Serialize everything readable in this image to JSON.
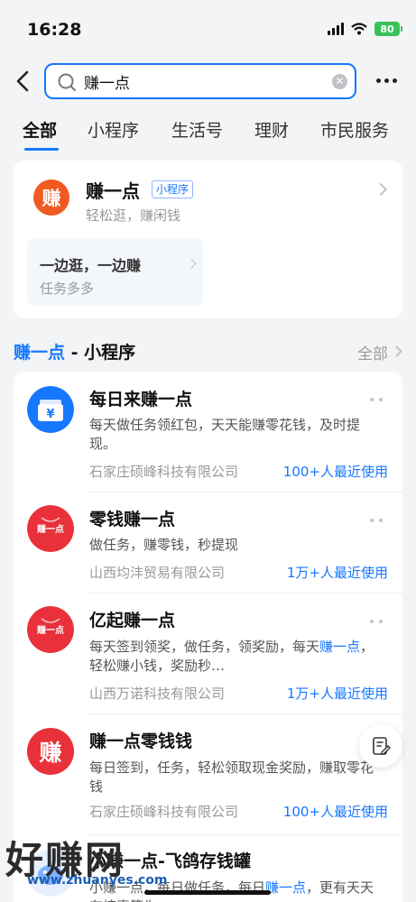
{
  "status_bar": {
    "time": "16:28",
    "battery": "80"
  },
  "search": {
    "value": "赚一点",
    "placeholder": ""
  },
  "tabs": [
    {
      "label": "全部",
      "active": true
    },
    {
      "label": "小程序"
    },
    {
      "label": "生活号"
    },
    {
      "label": "理财"
    },
    {
      "label": "市民服务"
    }
  ],
  "top_result": {
    "logo_char": "赚",
    "title": "赚一点",
    "badge": "小程序",
    "subtitle": "轻松逛，赚闲钱",
    "service": {
      "title": "一边逛，一边赚",
      "subtitle": "任务多多"
    }
  },
  "section": {
    "title_highlight": "赚一点",
    "title_rest": " - 小程序",
    "all_label": "全部"
  },
  "items": [
    {
      "title": "每日来赚一点",
      "desc": "每天做任务领红包，天天能赚零花钱，及时提现。",
      "company": "石家庄硕峰科技有限公司",
      "usage": "100+人最近使用",
      "logo": "wallet-icon"
    },
    {
      "title": "零钱赚一点",
      "desc": "做任务，赚零钱，秒提现",
      "company": "山西均沣贸易有限公司",
      "usage": "1万+人最近使用",
      "logo": "赚一点"
    },
    {
      "title": "亿起赚一点",
      "desc_a": "每天签到领奖，做任务，领奖励，每天",
      "desc_hl": "赚一点",
      "desc_b": "，轻松赚小钱，奖励秒…",
      "company": "山西万诺科技有限公司",
      "usage": "1万+人最近使用",
      "logo": "赚一点"
    },
    {
      "title": "赚一点零钱钱",
      "desc": "每日签到，任务，轻松领取现金奖励，赚取零花钱",
      "company": "石家庄硕峰科技有限公司",
      "usage": "100+人最近使用",
      "logo": "赚"
    },
    {
      "title": "小赚一点-飞鸽存钱罐",
      "desc_a": "小赚一点，每日做任务，每日",
      "desc_hl": "赚一点",
      "desc_b": "，更有天天有惊喜等你",
      "logo": "piggy-icon"
    }
  ],
  "watermark": {
    "text": "好赚网",
    "url": "www.zhuanyes.com"
  },
  "colors": {
    "accent": "#1677ff",
    "logo_orange": "#f15a22",
    "logo_red": "#e8313a"
  }
}
